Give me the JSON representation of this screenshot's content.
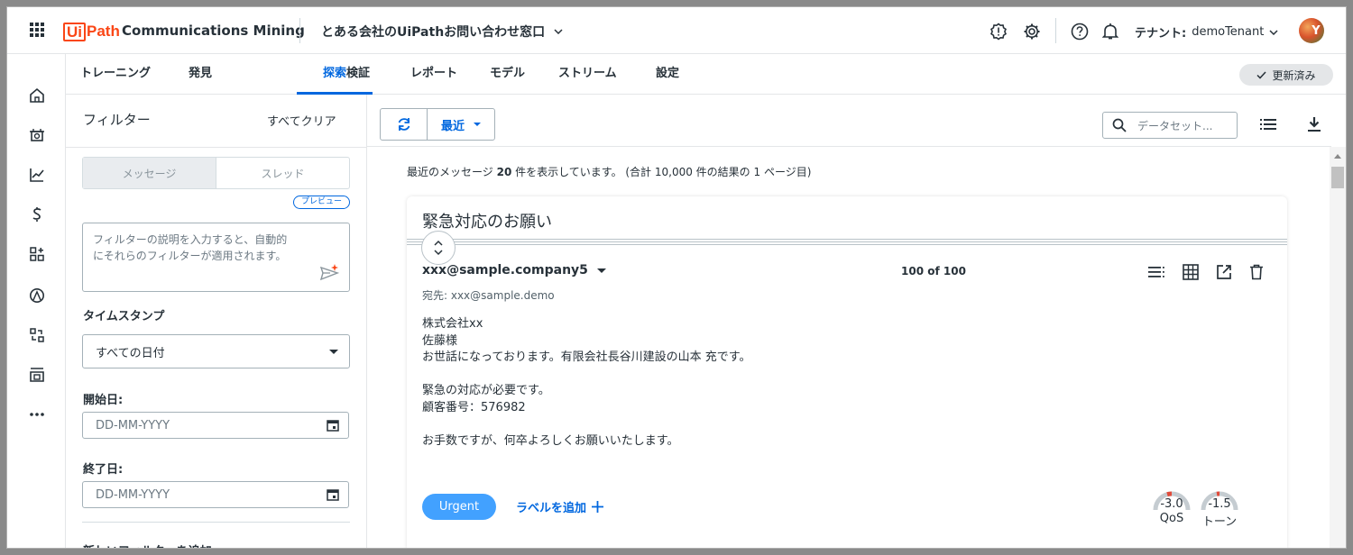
{
  "app": {
    "brand_ui": "Ui",
    "brand_path": "Path",
    "product": "Communications Mining",
    "dataset": "とある会社のUiPathお問い合わせ窓口",
    "tenant_label": "テナント:",
    "tenant_name": "demoTenant",
    "avatar_letter": "Y"
  },
  "tabs": [
    {
      "label": "トレーニング"
    },
    {
      "label": "発見"
    },
    {
      "label": "探索"
    },
    {
      "label": "検証"
    },
    {
      "label": "レポート"
    },
    {
      "label": "モデル"
    },
    {
      "label": "ストリーム"
    },
    {
      "label": "設定"
    }
  ],
  "status": {
    "updated": "更新済み"
  },
  "filters": {
    "title": "フィルター",
    "clear_all": "すべてクリア",
    "toggle_messages": "メッセージ",
    "toggle_threads": "スレッド",
    "preview_badge": "プレビュー",
    "description_placeholder": "フィルターの説明を入力すると、自動的\nにそれらのフィルターが適用されます。",
    "timestamp_label": "タイムスタンプ",
    "date_select": "すべての日付",
    "start_label": "開始日:",
    "end_label": "終了日:",
    "date_placeholder": "DD-MM-YYYY",
    "add_filter": "新しいフィルターを追加"
  },
  "toolbar": {
    "sort": "最近",
    "search_placeholder": "データセット..."
  },
  "results": {
    "prefix": "最近のメッセージ",
    "count": "20",
    "suffix": "件を表示しています。 (合計 10,000 件の結果の 1 ページ目)"
  },
  "message": {
    "subject": "緊急対応のお願い",
    "sender": "xxx@sample.company5",
    "position": "100 of 100",
    "recipient": "宛先: xxx@sample.demo",
    "body_lines": [
      "株式会社xx",
      "佐藤様",
      "お世話になっております。有限会社長谷川建設の山本 充です。",
      "",
      "緊急の対応が必要です。",
      "顧客番号：576982",
      "",
      "お手数ですが、何卒よろしくお願いいたします。"
    ],
    "label": "Urgent",
    "add_label": "ラベルを追加",
    "qos_value": "-3.0",
    "qos_label": "QoS",
    "tone_value": "-1.5",
    "tone_label": "トーン"
  },
  "colors": {
    "primary": "#0067df",
    "brand_orange": "#fa4616",
    "label_blue": "#42a1ff",
    "gauge_red": "#e04b3a"
  }
}
